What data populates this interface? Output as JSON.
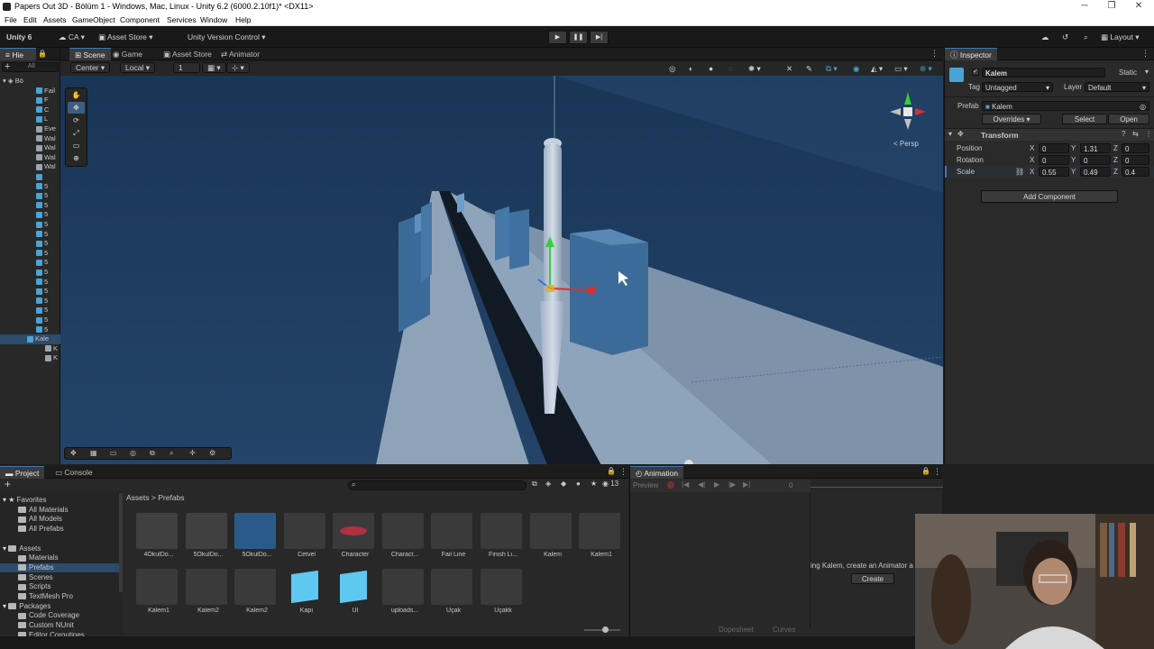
{
  "window": {
    "title": "Papers Out 3D - Bölüm 1 - Windows, Mac, Linux - Unity 6.2 (6000.2.10f1)* <DX11>",
    "minimize": "─",
    "restore": "❐",
    "close": "✕"
  },
  "menu": [
    "File",
    "Edit",
    "Assets",
    "GameObject",
    "Component",
    "Services",
    "Window",
    "Help"
  ],
  "toolbar": {
    "unity_label": "Unity 6",
    "account": "CA",
    "asset_store": "Asset Store",
    "version_control": "Unity Version Control",
    "layout": "Layout",
    "play": "▶",
    "pause": "❚❚",
    "step": "▶|"
  },
  "hierarchy": {
    "tab": "Hie",
    "search_placeholder": "All",
    "scene_name": "Bö",
    "items": [
      "Fail",
      "F",
      "C",
      "L",
      "Eve",
      "Wal",
      "Wal",
      "Wal",
      "Wal",
      "",
      "5",
      "5",
      "5",
      "5",
      "5",
      "5",
      "5",
      "5",
      "5",
      "5",
      "5",
      "5",
      "5",
      "5",
      "5",
      "5",
      "Kale",
      "K",
      "K"
    ]
  },
  "scene": {
    "tabs": [
      "Scene",
      "Game",
      "Asset Store",
      "Animator"
    ],
    "pivot": "Center",
    "space": "Local",
    "grid": "1",
    "persp_label": "< Persp",
    "tools": [
      "✋",
      "✥",
      "⟳",
      "⤢",
      "▭",
      "⊕"
    ]
  },
  "inspector": {
    "tab": "Inspector",
    "object_name": "Kalem",
    "static_label": "Static",
    "tag_label": "Tag",
    "tag_value": "Untagged",
    "layer_label": "Layer",
    "layer_value": "Default",
    "prefab_label": "Prefab",
    "prefab_value": "Kalem",
    "overrides": "Overrides",
    "select": "Select",
    "open": "Open",
    "transform_title": "Transform",
    "position_label": "Position",
    "rotation_label": "Rotation",
    "scale_label": "Scale",
    "position": {
      "x": "0",
      "y": "1.31",
      "z": "0"
    },
    "rotation": {
      "x": "0",
      "y": "0",
      "z": "0"
    },
    "scale": {
      "x": "0.55",
      "y": "0.49",
      "z": "0.4"
    },
    "add_component": "Add Component"
  },
  "project": {
    "tabs": [
      "Project",
      "Console"
    ],
    "breadcrumb_root": "Assets",
    "breadcrumb_sep": ">",
    "breadcrumb_current": "Prefabs",
    "count": "13",
    "tree": [
      {
        "label": "Favorites",
        "indent": 0,
        "star": true
      },
      {
        "label": "All Materials",
        "indent": 1
      },
      {
        "label": "All Models",
        "indent": 1
      },
      {
        "label": "All Prefabs",
        "indent": 1
      },
      {
        "label": "",
        "indent": 0
      },
      {
        "label": "Assets",
        "indent": 0
      },
      {
        "label": "Materials",
        "indent": 1
      },
      {
        "label": "Prefabs",
        "indent": 1,
        "selected": true
      },
      {
        "label": "Scenes",
        "indent": 1
      },
      {
        "label": "Scripts",
        "indent": 1
      },
      {
        "label": "TextMesh Pro",
        "indent": 1
      },
      {
        "label": "Packages",
        "indent": 0
      },
      {
        "label": "Code Coverage",
        "indent": 1
      },
      {
        "label": "Custom NUnit",
        "indent": 1
      },
      {
        "label": "Editor Coroutines",
        "indent": 1
      }
    ],
    "assets_row1": [
      "4OkulDo...",
      "5OkulDo...",
      "5OkulDo...",
      "Cetvel",
      "Character",
      "Charact...",
      "Fail Line",
      "Finish Li...",
      "Kalem",
      "Kalem1"
    ],
    "assets_row2": [
      "Kalem1",
      "Kalem2",
      "Kalem2",
      "Kapı",
      "UI",
      "uploads...",
      "Uçak",
      "Uçakk"
    ]
  },
  "animation": {
    "tab": "Animation",
    "preview": "Preview",
    "frame": "0",
    "message": "ing Kalem, create an Animator a",
    "create": "Create",
    "dopesheet": "Dopesheet",
    "curves": "Curves"
  },
  "colors": {
    "accent": "#3a79bb",
    "sky": "#1f3e62",
    "cube": "#4aa3d4"
  }
}
